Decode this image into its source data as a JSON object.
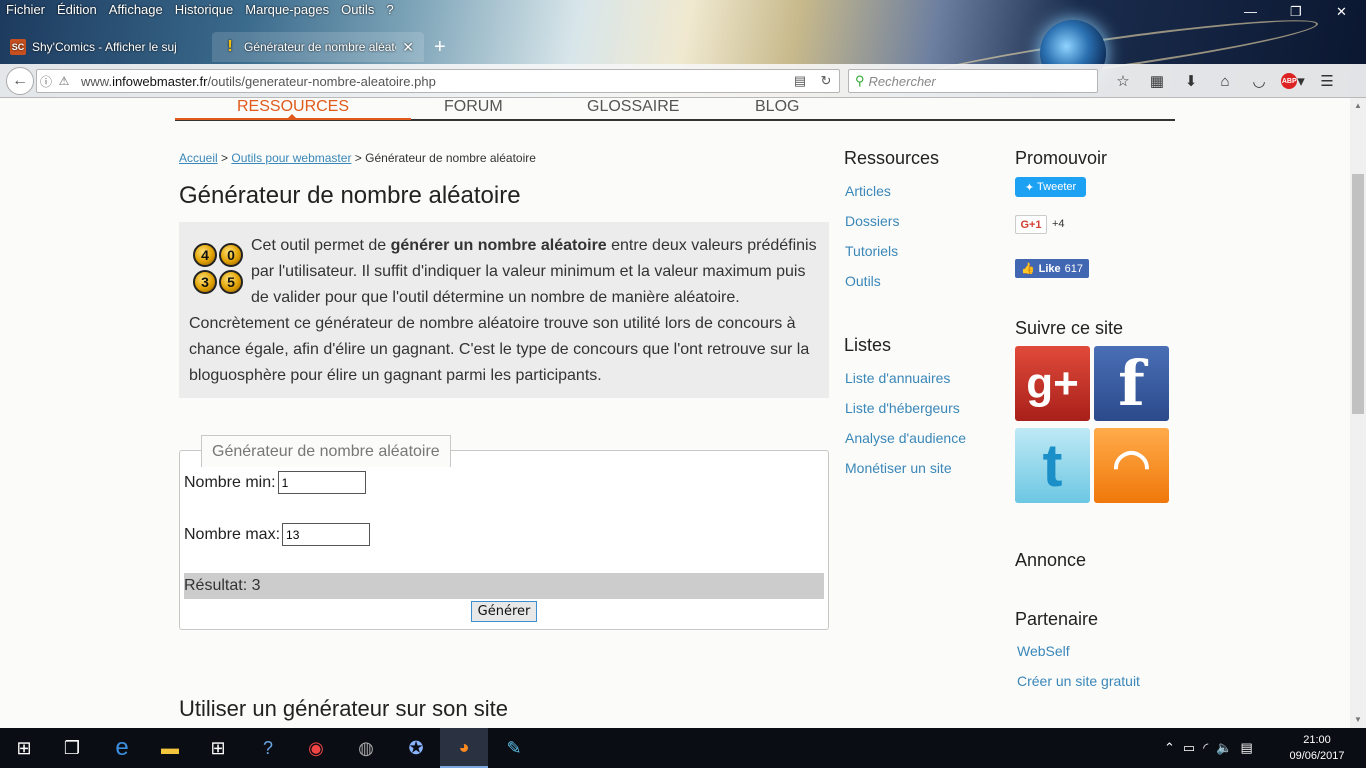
{
  "browser": {
    "menu": [
      "Fichier",
      "Édition",
      "Affichage",
      "Historique",
      "Marque-pages",
      "Outils",
      "?"
    ],
    "tabs": [
      {
        "label": "Shy'Comics - Afficher le suj"
      },
      {
        "label": "Générateur de nombre aléato"
      }
    ],
    "url_prefix": "www.",
    "url_domain": "infowebmaster.fr",
    "url_path": "/outils/generateur-nombre-aleatoire.php",
    "search_placeholder": "Rechercher",
    "abp_label": "ABP"
  },
  "site_nav": {
    "items": [
      "RESSOURCES",
      "FORUM",
      "GLOSSAIRE",
      "BLOG"
    ]
  },
  "breadcrumb": {
    "home": "Accueil",
    "tools": "Outils pour webmaster",
    "current": "Générateur de nombre aléatoire",
    "sep": ">"
  },
  "page_title": "Générateur de nombre aléatoire",
  "intro": {
    "dice": [
      "4",
      "0",
      "3",
      "5"
    ],
    "text_before": "Cet outil permet de ",
    "text_bold": "générer un nombre aléatoire",
    "text_after": " entre deux valeurs prédéfinis par l'utilisateur. Il suffit d'indiquer la valeur minimum et la valeur maximum puis de valider pour que l'outil détermine un nombre de manière aléatoire. Concrètement ce générateur de nombre aléatoire trouve son utilité lors de concours à chance égale, afin d'élire un gagnant. C'est le type de concours que l'ont retrouve sur la bloguosphère pour élire un gagnant parmi les participants."
  },
  "generator": {
    "legend": "Générateur de nombre aléatoire",
    "min_label": "Nombre min:",
    "min_value": "1",
    "max_label": "Nombre max:",
    "max_value": "13",
    "result": "Résultat: 3",
    "button": "Générer"
  },
  "subheading": "Utiliser un générateur sur son site",
  "sidebar_left": {
    "ressources_title": "Ressources",
    "ressources": [
      "Articles",
      "Dossiers",
      "Tutoriels",
      "Outils"
    ],
    "listes_title": "Listes",
    "listes": [
      "Liste d'annuaires",
      "Liste d'hébergeurs",
      "Analyse d'audience",
      "Monétiser un site"
    ]
  },
  "sidebar_right": {
    "promo_title": "Promouvoir",
    "tweet": "Tweeter",
    "gplus": "G+1",
    "gplus_count": "+4",
    "like": "Like",
    "like_count": "617",
    "follow_title": "Suivre ce site",
    "annonce_title": "Annonce",
    "partner_title": "Partenaire",
    "partners": [
      "WebSelf",
      "Créer un site gratuit"
    ]
  },
  "taskbar": {
    "time": "21:00",
    "date": "09/06/2017"
  }
}
